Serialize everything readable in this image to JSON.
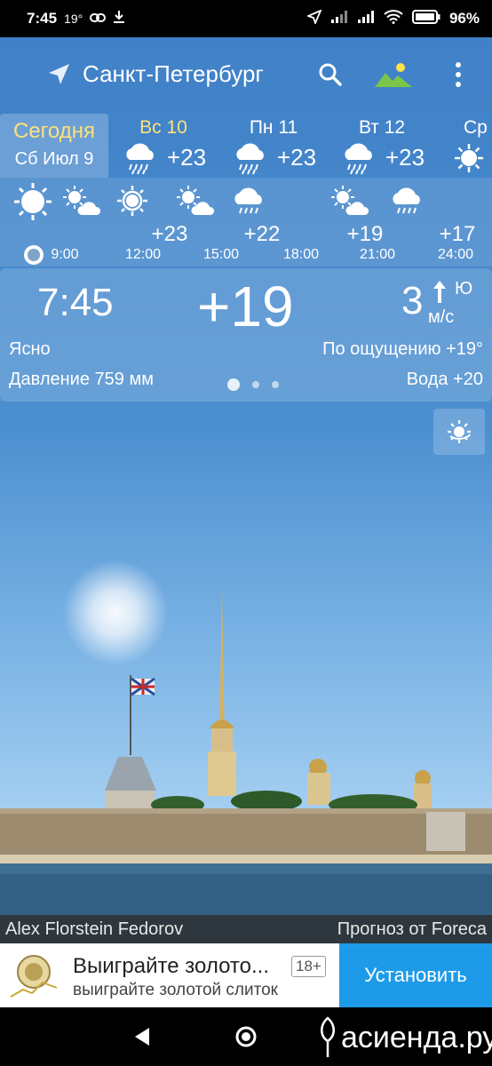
{
  "status_bar": {
    "time": "7:45",
    "temp": "19°",
    "battery": "96%"
  },
  "header": {
    "city": "Санкт-Петербург"
  },
  "days": {
    "today_label": "Сегодня",
    "today_date": "Сб Июл 9",
    "items": [
      {
        "name": "Вс 10",
        "temp": "+23",
        "icon": "rain-cloud-icon"
      },
      {
        "name": "Пн 11",
        "temp": "+23",
        "icon": "rain-cloud-icon"
      },
      {
        "name": "Вт 12",
        "temp": "+23",
        "icon": "rain-cloud-icon"
      },
      {
        "name": "Ср",
        "temp": "",
        "icon": "sun-icon"
      }
    ]
  },
  "hourly": [
    {
      "time": "9:00",
      "temp": "",
      "icon": "sun-icon"
    },
    {
      "time": "12:00",
      "temp": "+23",
      "icon": "partly-cloudy-icon"
    },
    {
      "time": "15:00",
      "temp": "+22",
      "icon": "partly-cloudy-icon"
    },
    {
      "time": "18:00",
      "temp": "",
      "icon": "rain-cloud-icon"
    },
    {
      "time": "21:00",
      "temp": "+19",
      "icon": "partly-cloudy-icon"
    },
    {
      "time": "24:00",
      "temp": "+17",
      "icon": "rain-cloud-icon"
    }
  ],
  "current": {
    "time": "7:45",
    "temp": "+19",
    "wind_speed": "3",
    "wind_dir": "Ю",
    "wind_unit": "м/с",
    "condition": "Ясно",
    "feels_like": "По ощущению +19°",
    "pressure": "Давление 759 мм",
    "water": "Вода +20"
  },
  "credits": {
    "photo_author": "Alex Florstein Fedorov",
    "forecast_by": "Прогноз от Foreca"
  },
  "ad": {
    "title": "Выиграйте золото...",
    "age": "18+",
    "subtitle": "выиграйте золотой слиток",
    "button": "Установить"
  },
  "watermark": "асиенда.ру",
  "colors": {
    "accent_yellow": "#ffe17a",
    "ad_button": "#1e9be8"
  }
}
